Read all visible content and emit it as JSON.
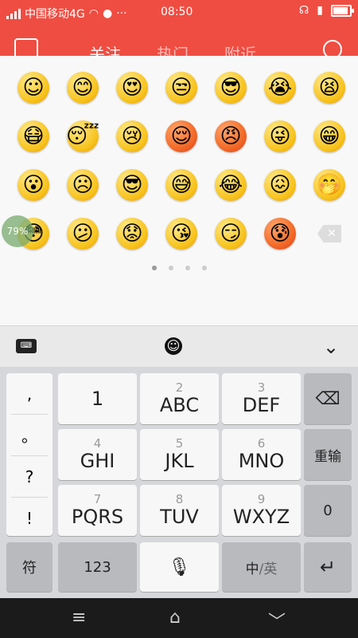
{
  "status_bar": {
    "carrier": "中国移动4G",
    "time": "08:50",
    "battery_level": 0.9,
    "more_indicator": "···"
  },
  "app_header": {
    "tabs": [
      "关注",
      "热门",
      "附近"
    ]
  },
  "emoji_panel": {
    "rows": [
      [
        "smile",
        "bashful",
        "heart-eyes",
        "angry-glance",
        "cool-sunglasses",
        "crying-waterfall",
        "tired-x-eyes"
      ],
      [
        "mouth-taped",
        "sleepy-zzz",
        "sob",
        "red-sleeping",
        "red-angry",
        "tongue-wink",
        "big-grin"
      ],
      [
        "shocked",
        "sad",
        "sunglasses-frown",
        "sweat-smile",
        "laugh-tears",
        "nervous-shake",
        "shush-hand"
      ],
      [
        "flushed-smile",
        "pout",
        "puzzled",
        "kiss",
        "smug",
        "red-scared-sweat",
        "delete-key"
      ]
    ],
    "floating_badge_text": "79%",
    "page_count": 4,
    "active_page": 1
  },
  "keyboard_toolbar": {
    "keyboard_icon": "keyboard-icon",
    "emoji_icon": "emoji-icon",
    "collapse_icon": "chevron-down-icon"
  },
  "keyboard": {
    "punctuation": [
      ",",
      "。",
      "?",
      "!"
    ],
    "keys": {
      "k1": {
        "num": "",
        "label": "1"
      },
      "k2": {
        "num": "2",
        "label": "ABC"
      },
      "k3": {
        "num": "3",
        "label": "DEF"
      },
      "k4": {
        "num": "4",
        "label": "GHI"
      },
      "k5": {
        "num": "5",
        "label": "JKL"
      },
      "k6": {
        "num": "6",
        "label": "MNO"
      },
      "k7": {
        "num": "7",
        "label": "PQRS"
      },
      "k8": {
        "num": "8",
        "label": "TUV"
      },
      "k9": {
        "num": "9",
        "label": "WXYZ"
      }
    },
    "reinput": "重输",
    "zero": "0",
    "symbols": "符",
    "numbers": "123",
    "lang_zh": "中",
    "lang_sep": "/",
    "lang_en": "英"
  },
  "colors": {
    "accent": "#ef4d42",
    "keyboard_bg": "#d6d7da",
    "nav_bg": "#1b1b1b"
  }
}
